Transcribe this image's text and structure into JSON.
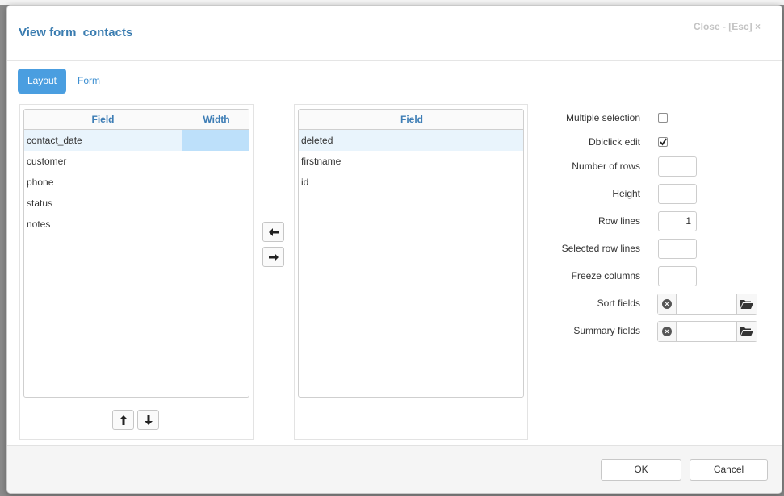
{
  "dialog": {
    "title": "View form",
    "item_name": "contacts",
    "close_label": "Close - [Esc] ×"
  },
  "tabs": [
    {
      "label": "Layout",
      "active": true
    },
    {
      "label": "Form",
      "active": false
    }
  ],
  "left_grid": {
    "headers": [
      "Field",
      "Width"
    ],
    "rows": [
      {
        "field": "contact_date",
        "width": "",
        "selected": true
      },
      {
        "field": "customer",
        "width": ""
      },
      {
        "field": "phone",
        "width": ""
      },
      {
        "field": "status",
        "width": ""
      },
      {
        "field": "notes",
        "width": ""
      }
    ]
  },
  "right_grid": {
    "headers": [
      "Field"
    ],
    "rows": [
      {
        "field": "deleted",
        "selected": true
      },
      {
        "field": "firstname"
      },
      {
        "field": "id"
      }
    ]
  },
  "move_buttons": {
    "left_icon": "arrow-left-icon",
    "right_icon": "arrow-right-icon",
    "up_icon": "arrow-up-icon",
    "down_icon": "arrow-down-icon"
  },
  "options": {
    "multiple_selection": {
      "label": "Multiple selection",
      "checked": false
    },
    "dblclick_edit": {
      "label": "Dblclick edit",
      "checked": true
    },
    "number_of_rows": {
      "label": "Number of rows",
      "value": ""
    },
    "height": {
      "label": "Height",
      "value": ""
    },
    "row_lines": {
      "label": "Row lines",
      "value": "1"
    },
    "selected_row_lines": {
      "label": "Selected row lines",
      "value": ""
    },
    "freeze_columns": {
      "label": "Freeze columns",
      "value": ""
    },
    "sort_fields": {
      "label": "Sort fields",
      "value": ""
    },
    "summary_fields": {
      "label": "Summary fields",
      "value": ""
    }
  },
  "footer": {
    "ok_label": "OK",
    "cancel_label": "Cancel"
  },
  "colors": {
    "accent": "#4a9ee0",
    "title": "#3a7cb0",
    "selected_row": "#e9f4fc"
  }
}
